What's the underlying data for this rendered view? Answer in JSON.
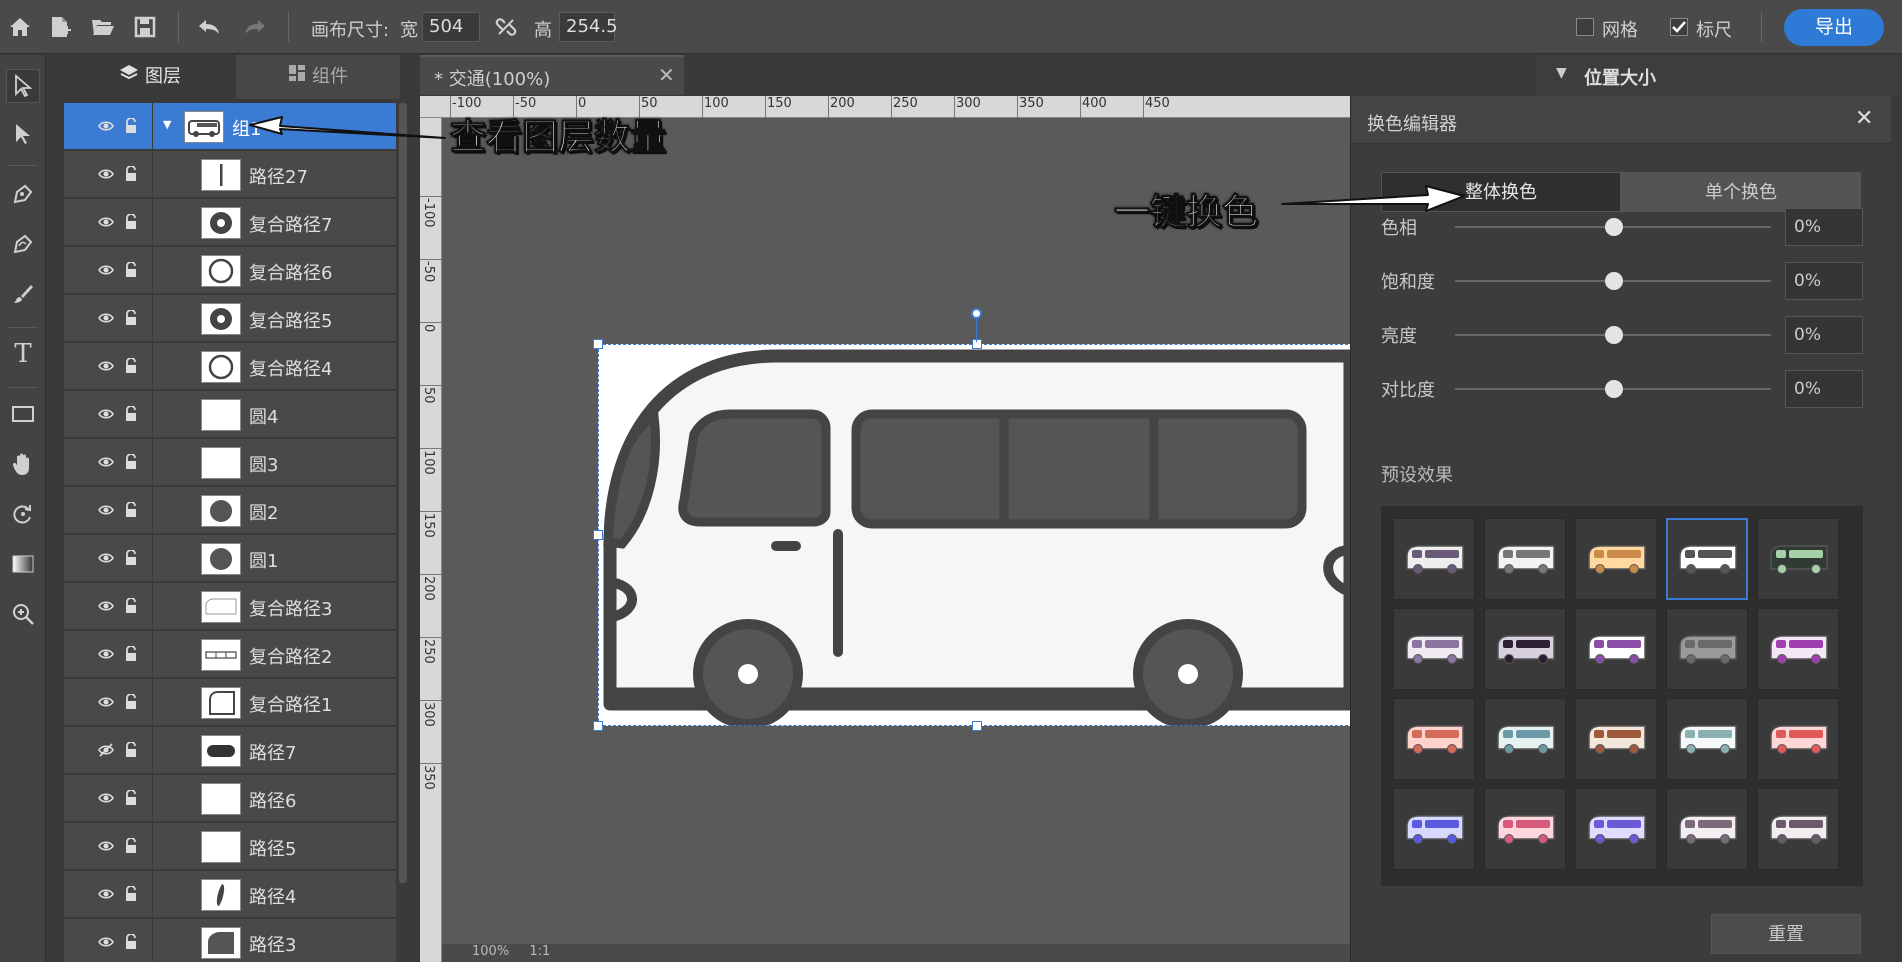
{
  "topbar": {
    "canvas_size_label": "画布尺寸:",
    "width_label": "宽",
    "width_value": "504",
    "height_label": "高",
    "height_value": "254.5",
    "grid_label": "网格",
    "ruler_label": "标尺",
    "export_label": "导出"
  },
  "panel": {
    "tab_layers": "图层",
    "tab_components": "组件"
  },
  "layers": [
    {
      "name": "组1"
    },
    {
      "name": "路径27"
    },
    {
      "name": "复合路径7"
    },
    {
      "name": "复合路径6"
    },
    {
      "name": "复合路径5"
    },
    {
      "name": "复合路径4"
    },
    {
      "name": "圆4"
    },
    {
      "name": "圆3"
    },
    {
      "name": "圆2"
    },
    {
      "name": "圆1"
    },
    {
      "name": "复合路径3"
    },
    {
      "name": "复合路径2"
    },
    {
      "name": "复合路径1"
    },
    {
      "name": "路径7"
    },
    {
      "name": "路径6"
    },
    {
      "name": "路径5"
    },
    {
      "name": "路径4"
    },
    {
      "name": "路径3"
    }
  ],
  "document": {
    "tab_title": "* 交通(100%)",
    "ruler_h": [
      "-100",
      "-50",
      "0",
      "50",
      "100",
      "150",
      "200",
      "250",
      "300",
      "350",
      "400",
      "450"
    ],
    "ruler_v": [
      "-100",
      "-50",
      "0",
      "50",
      "100",
      "150",
      "200",
      "250",
      "300",
      "350"
    ],
    "zoom_partial": "100%",
    "ratio_partial": "1:1"
  },
  "right_panel": {
    "section_title": "位置大小"
  },
  "color_editor": {
    "title": "换色编辑器",
    "seg_whole": "整体换色",
    "seg_single": "单个换色",
    "sliders": [
      {
        "label": "色相",
        "value": "0%"
      },
      {
        "label": "饱和度",
        "value": "0%"
      },
      {
        "label": "亮度",
        "value": "0%"
      },
      {
        "label": "对比度",
        "value": "0%"
      }
    ],
    "presets_label": "预设效果",
    "presets": [
      {
        "body": "#eeeeee",
        "window": "#6a5a7a",
        "sel": false
      },
      {
        "body": "#f2f2f2",
        "window": "#777777",
        "sel": false
      },
      {
        "body": "#ffd9a0",
        "window": "#c98a4a",
        "sel": false
      },
      {
        "body": "#ffffff",
        "window": "#555555",
        "sel": true
      },
      {
        "body": "#2f3b33",
        "window": "#a8d0a8",
        "sel": false
      },
      {
        "body": "#f0eaf2",
        "window": "#8a74a0",
        "sel": false
      },
      {
        "body": "#d8d0dc",
        "window": "#2a1f33",
        "sel": false
      },
      {
        "body": "#ffffff",
        "window": "#8a4ea8",
        "sel": false
      },
      {
        "body": "#9a9a9a",
        "window": "#6a6a6a",
        "sel": false
      },
      {
        "body": "#f3e6f5",
        "window": "#a040b0",
        "sel": false
      },
      {
        "body": "#ffd3cc",
        "window": "#d46a5a",
        "sel": false
      },
      {
        "body": "#e6f2f2",
        "window": "#6a9aa8",
        "sel": false
      },
      {
        "body": "#f5e6dc",
        "window": "#a0583a",
        "sel": false
      },
      {
        "body": "#f4f8f8",
        "window": "#8ab0b0",
        "sel": false
      },
      {
        "body": "#ffd6d6",
        "window": "#e05a5a",
        "sel": false
      },
      {
        "body": "#d6d8ff",
        "window": "#5a5ae0",
        "sel": false
      },
      {
        "body": "#ffd6de",
        "window": "#d85a7a",
        "sel": false
      },
      {
        "body": "#e0dcff",
        "window": "#6a5ad8",
        "sel": false
      },
      {
        "body": "#f2eef2",
        "window": "#7a6a7a",
        "sel": false
      },
      {
        "body": "#f2eef0",
        "window": "#6a5a6a",
        "sel": false
      }
    ],
    "reset_label": "重置"
  },
  "annotations": {
    "layers_count": "查看图层数量",
    "one_click": "一键换色"
  }
}
